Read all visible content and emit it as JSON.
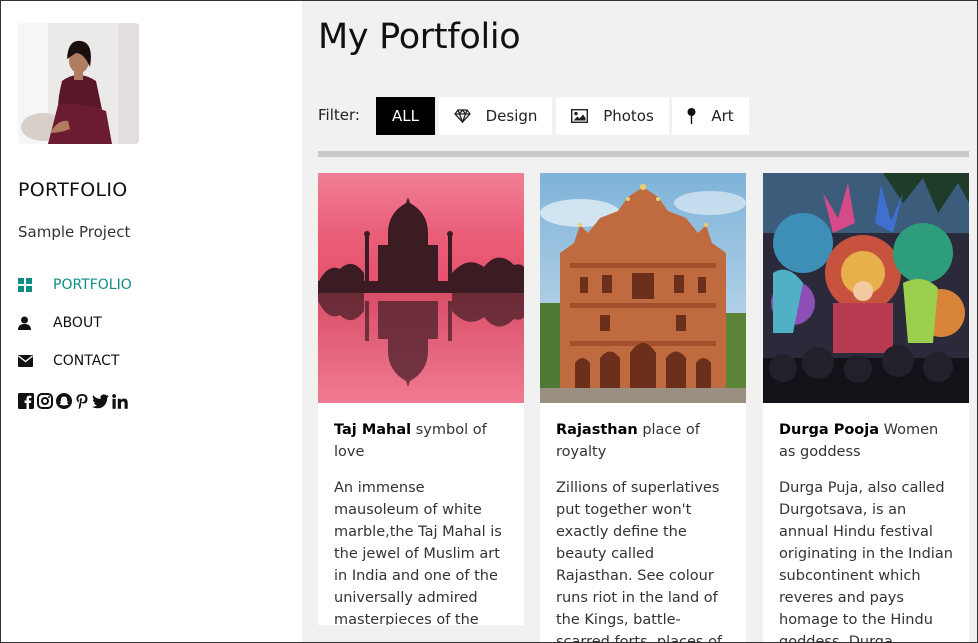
{
  "sidebar": {
    "brand": "PORTFOLIO",
    "subtitle": "Sample Project",
    "nav": [
      {
        "label": "PORTFOLIO",
        "icon": "grid-icon",
        "active": true
      },
      {
        "label": "ABOUT",
        "icon": "user-icon",
        "active": false
      },
      {
        "label": "CONTACT",
        "icon": "envelope-icon",
        "active": false
      }
    ],
    "social_icons": [
      "facebook-icon",
      "instagram-icon",
      "snapchat-icon",
      "pinterest-icon",
      "twitter-icon",
      "linkedin-icon"
    ]
  },
  "main": {
    "title": "My Portfolio",
    "filter_label": "Filter:",
    "filters": [
      {
        "label": "ALL",
        "active": true
      },
      {
        "label": "Design",
        "icon": "diamond-icon"
      },
      {
        "label": "Photos",
        "icon": "photo-icon"
      },
      {
        "label": "Art",
        "icon": "pin-icon"
      }
    ],
    "cards": [
      {
        "title_bold": "Taj Mahal",
        "title_rest": "symbol of love",
        "text": "An immense mausoleum of white marble,the Taj Mahal is the jewel of Muslim art in India and one of the universally admired masterpieces of the world's heritage."
      },
      {
        "title_bold": "Rajasthan",
        "title_rest": "place of royalty",
        "text": "Zillions of superlatives put together won't exactly define the beauty called Rajasthan. See colour runs riot in the land of the Kings, battle-scarred forts, places of grandeur steeped in"
      },
      {
        "title_bold": "Durga Pooja",
        "title_rest": "Women as goddess",
        "text": "Durga Puja, also called Durgotsava, is an annual Hindu festival originating in the Indian subcontinent which reveres and pays homage to the Hindu goddess, Durga."
      }
    ]
  },
  "colors": {
    "accent": "#0f8d83",
    "page_bg": "#f1f1f1",
    "active_filter_bg": "#000000"
  }
}
